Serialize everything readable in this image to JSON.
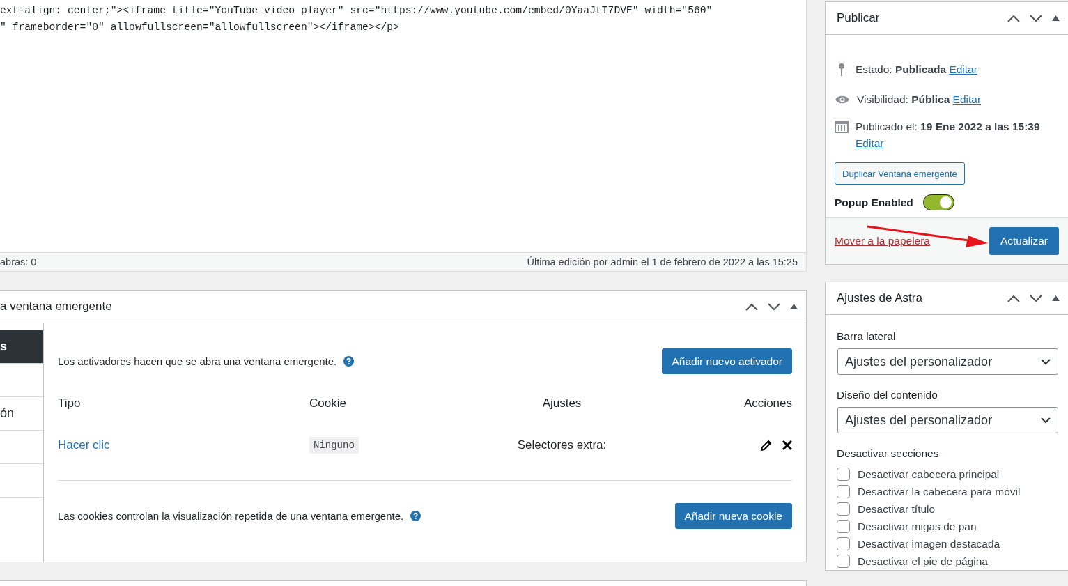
{
  "editor": {
    "code_lines": [
      "ext-align: center;\"><iframe title=\"YouTube video player\" src=\"https://www.youtube.com/embed/0YaaJtT7DVE\" width=\"560\"",
      "\" frameborder=\"0\" allowfullscreen=\"allowfullscreen\"></iframe></p>"
    ],
    "word_count": "abras: 0",
    "last_edit": "Última edición por admin el 1 de febrero de 2022 a las 15:25"
  },
  "popup_panel": {
    "title": "a ventana emergente",
    "tabs": [
      {
        "label": "s",
        "selected": true
      },
      {
        "selected": false
      },
      {
        "label": "ón",
        "selected": false
      }
    ],
    "triggers": {
      "description": "Los activadores hacen que se abra una ventana emergente.",
      "button": "Añadir nuevo activador",
      "columns": [
        "Tipo",
        "Cookie",
        "Ajustes",
        "Acciones"
      ],
      "rows": [
        {
          "type": "Hacer clic",
          "cookie": "Ninguno",
          "settings": "Selectores extra:"
        }
      ]
    },
    "cookies": {
      "description": "Las cookies controlan la visualización repetida de una ventana emergente.",
      "button": "Añadir nueva cookie"
    }
  },
  "publish": {
    "title": "Publicar",
    "status_label": "Estado:",
    "status_value": "Publicada",
    "status_edit": "Editar",
    "visibility_label": "Visibilidad:",
    "visibility_value": "Pública",
    "visibility_edit": "Editar",
    "date_label": "Publicado el:",
    "date_value": "19 Ene 2022 a las 15:39",
    "date_edit": "Editar",
    "duplicate_button": "Duplicar Ventana emergente",
    "popup_enabled": {
      "label": "Popup Enabled",
      "on": true
    },
    "trash_link": "Mover a la papelera",
    "update_button": "Actualizar"
  },
  "astra": {
    "title": "Ajustes de Astra",
    "sidebar_label": "Barra lateral",
    "sidebar_value": "Ajustes del personalizador",
    "layout_label": "Diseño del contenido",
    "layout_value": "Ajustes del personalizador",
    "sections_label": "Desactivar secciones",
    "sections": [
      {
        "label": "Desactivar cabecera principal",
        "checked": false
      },
      {
        "label": "Desactivar la cabecera para móvil",
        "checked": false
      },
      {
        "label": "Desactivar título",
        "checked": false
      },
      {
        "label": "Desactivar migas de pan",
        "checked": false
      },
      {
        "label": "Desactivar imagen destacada",
        "checked": false
      },
      {
        "label": "Desactivar el pie de página",
        "checked": false
      }
    ]
  }
}
